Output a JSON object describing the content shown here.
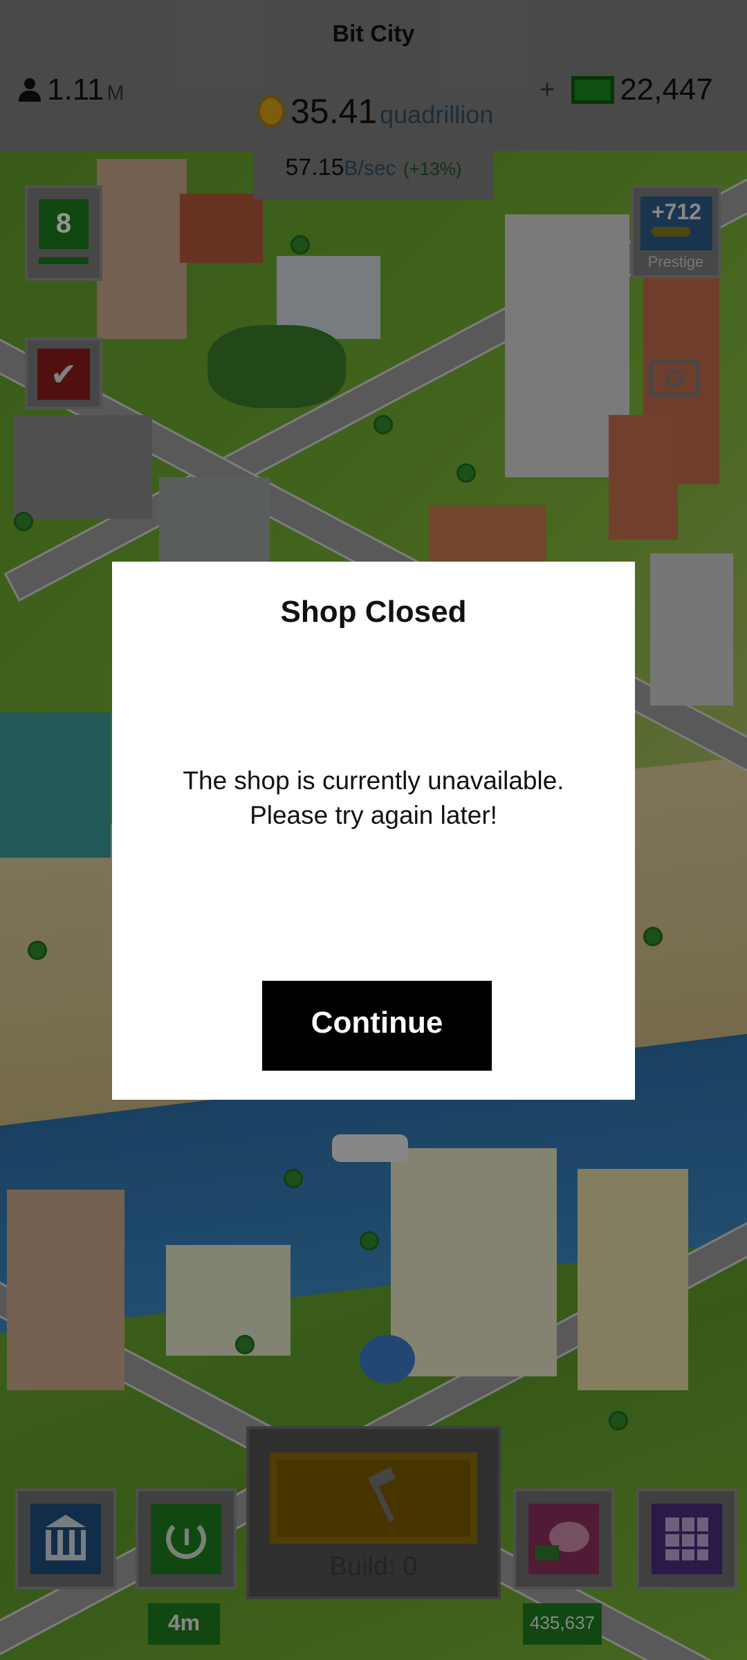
{
  "app": {
    "title": "Bit City"
  },
  "stats": {
    "population_value": "1.11",
    "population_unit": "M",
    "coins_value": "35.41",
    "coins_unit": "quadrillion",
    "income_value": "57.15",
    "income_unit": "B/sec",
    "income_bonus": "(+13%)",
    "cash_value": "22,447",
    "cash_add_symbol": "+"
  },
  "side": {
    "level": "8",
    "tasks_symbol": "✔",
    "prestige_value": "+712",
    "prestige_label": "Prestige"
  },
  "modal": {
    "title": "Shop Closed",
    "message_line1": "The shop is currently unavailable.",
    "message_line2": "Please try again later!",
    "continue_label": "Continue"
  },
  "toolbar": {
    "build_label": "Build: 0",
    "timer_badge": "4m",
    "cash_badge": "435,637"
  },
  "colors": {
    "overlay": "#000000",
    "modal_bg": "#ffffff",
    "continue_bg": "#000000",
    "level_green": "#1e7a1e",
    "bank_blue": "#1f4f7e",
    "grid_purple": "#4a2c7a",
    "piggy_pink": "#8a2f5a"
  },
  "icons": {
    "population": "person-icon",
    "coins": "coin-icon",
    "cash": "bill-icon",
    "tasks": "checkmark-icon",
    "prestige": "key-icon",
    "camera": "camera-icon",
    "bank": "bank-icon",
    "timer": "clock-refresh-icon",
    "build": "hammer-icon",
    "piggy": "piggy-bank-icon",
    "grid": "grid-menu-icon"
  }
}
